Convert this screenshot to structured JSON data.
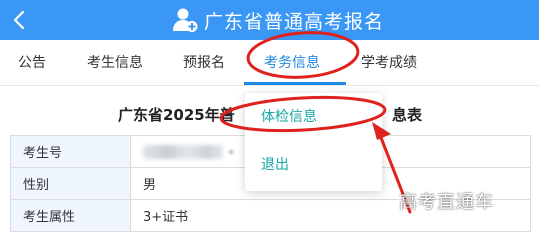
{
  "header": {
    "title": "广东省普通高考报名",
    "back_icon": "back-chevron-icon",
    "user_icon": "user-add-icon",
    "color": "#3b97f5"
  },
  "tabs": [
    {
      "label": "公告"
    },
    {
      "label": "考生信息"
    },
    {
      "label": "预报名"
    },
    {
      "label": "考务信息",
      "active": true
    },
    {
      "label": "学考成绩"
    }
  ],
  "table": {
    "title_prefix": "广东省2025年普",
    "title_suffix": "息表",
    "rows": [
      {
        "label": "考生号",
        "value": ""
      },
      {
        "label": "性别",
        "value": "男"
      },
      {
        "label": "考生属性",
        "value": "3+证书"
      }
    ]
  },
  "dropdown": {
    "items": [
      {
        "label": "体检信息"
      },
      {
        "label": "退出"
      }
    ],
    "text_color": "#19a8a4"
  },
  "annotation": {
    "highlight_color": "#e0221e"
  },
  "watermark": "高考直通车"
}
